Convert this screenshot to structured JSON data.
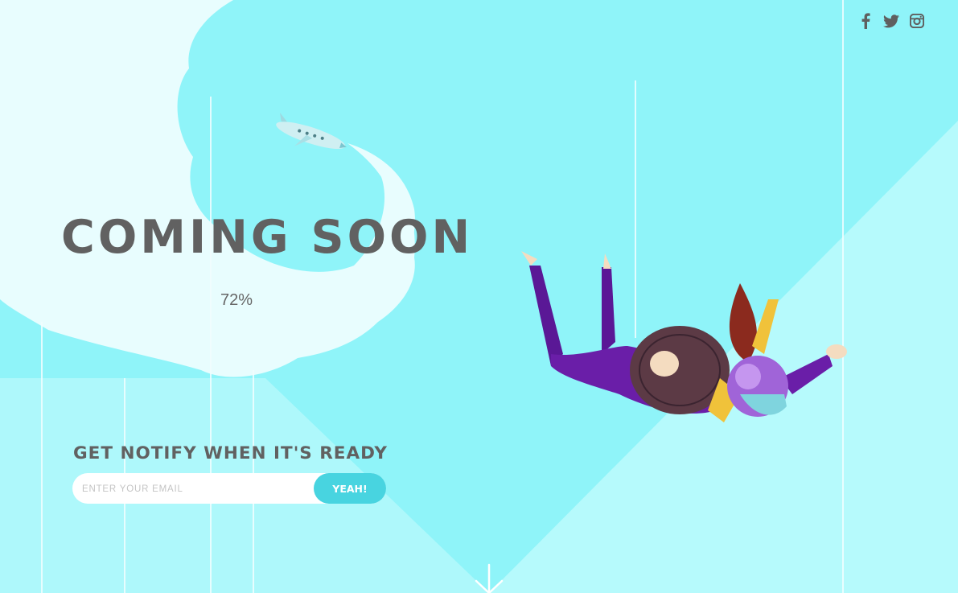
{
  "hero": {
    "title": "COMING SOON",
    "progress_text": "72%"
  },
  "notify": {
    "label": "GET NOTIFY WHEN IT'S READY",
    "email_placeholder": "ENTER YOUR EMAIL",
    "email_value": "",
    "submit_label": "YEAH!"
  },
  "social": {
    "icons": [
      "facebook-icon",
      "twitter-icon",
      "instagram-icon"
    ]
  },
  "illustration": {
    "elements": [
      "airplane",
      "skydiver",
      "smoke-trail"
    ]
  },
  "colors": {
    "sky": "#8ff4f9",
    "sky_light": "#b5f9fb",
    "cloud": "#e8fdfe",
    "text": "#616161",
    "accent_button": "#48d4e0",
    "suit_purple": "#6a1ea8"
  }
}
